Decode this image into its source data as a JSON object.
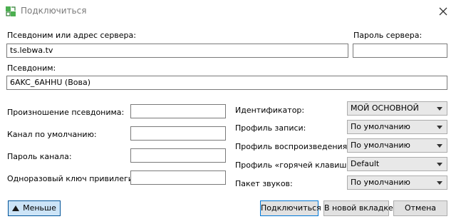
{
  "window": {
    "title": "Подключиться"
  },
  "server": {
    "address_label": "Псевдоним или адрес сервера:",
    "address_value": "ts.lebwa.tv",
    "password_label": "Пароль сервера:",
    "password_value": ""
  },
  "nickname": {
    "label": "Псевдоним:",
    "value": "6AKC_6AHHU (Вова)"
  },
  "left_fields": [
    {
      "label": "Произношение псевдонима:",
      "value": ""
    },
    {
      "label": "Канал по умолчанию:",
      "value": ""
    },
    {
      "label": "Пароль канала:",
      "value": ""
    },
    {
      "label": "Одноразовый ключ привилегии:",
      "value": ""
    }
  ],
  "right_fields": [
    {
      "label": "Идентификатор:",
      "value": "МОЙ ОСНОВНОЙ"
    },
    {
      "label": "Профиль записи:",
      "value": "По умолчанию"
    },
    {
      "label": "Профиль воспроизведения:",
      "value": "По умолчанию"
    },
    {
      "label": "Профиль «горячей клавиши»:",
      "value": "Default"
    },
    {
      "label": "Пакет звуков:",
      "value": "По умолчанию"
    }
  ],
  "buttons": {
    "less": "Меньше",
    "connect": "Подключиться",
    "new_tab": "В новой вкладке",
    "cancel": "Отмена"
  },
  "icons": {
    "app": "app-connect-icon",
    "close": "close-icon",
    "less": "triangle-up-icon"
  },
  "colors": {
    "accent": "#0078d7",
    "toggle_bg": "#cce4f7"
  }
}
